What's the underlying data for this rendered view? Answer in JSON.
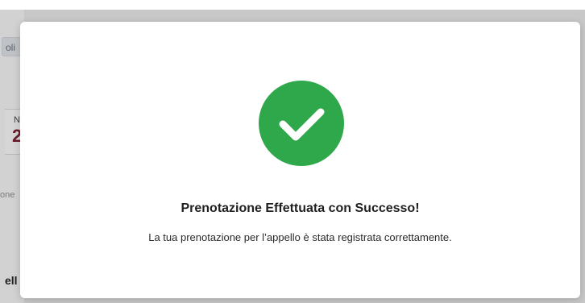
{
  "background": {
    "chip_text": "oli",
    "card_label": "N",
    "card_value": "2",
    "side_text": "one",
    "bottom_text": "ell"
  },
  "modal": {
    "icon": "check-circle-icon",
    "accent_color": "#2ea84a",
    "title": "Prenotazione Effettuata con Successo!",
    "message": "La tua prenotazione per l’appello è stata registrata correttamente."
  }
}
